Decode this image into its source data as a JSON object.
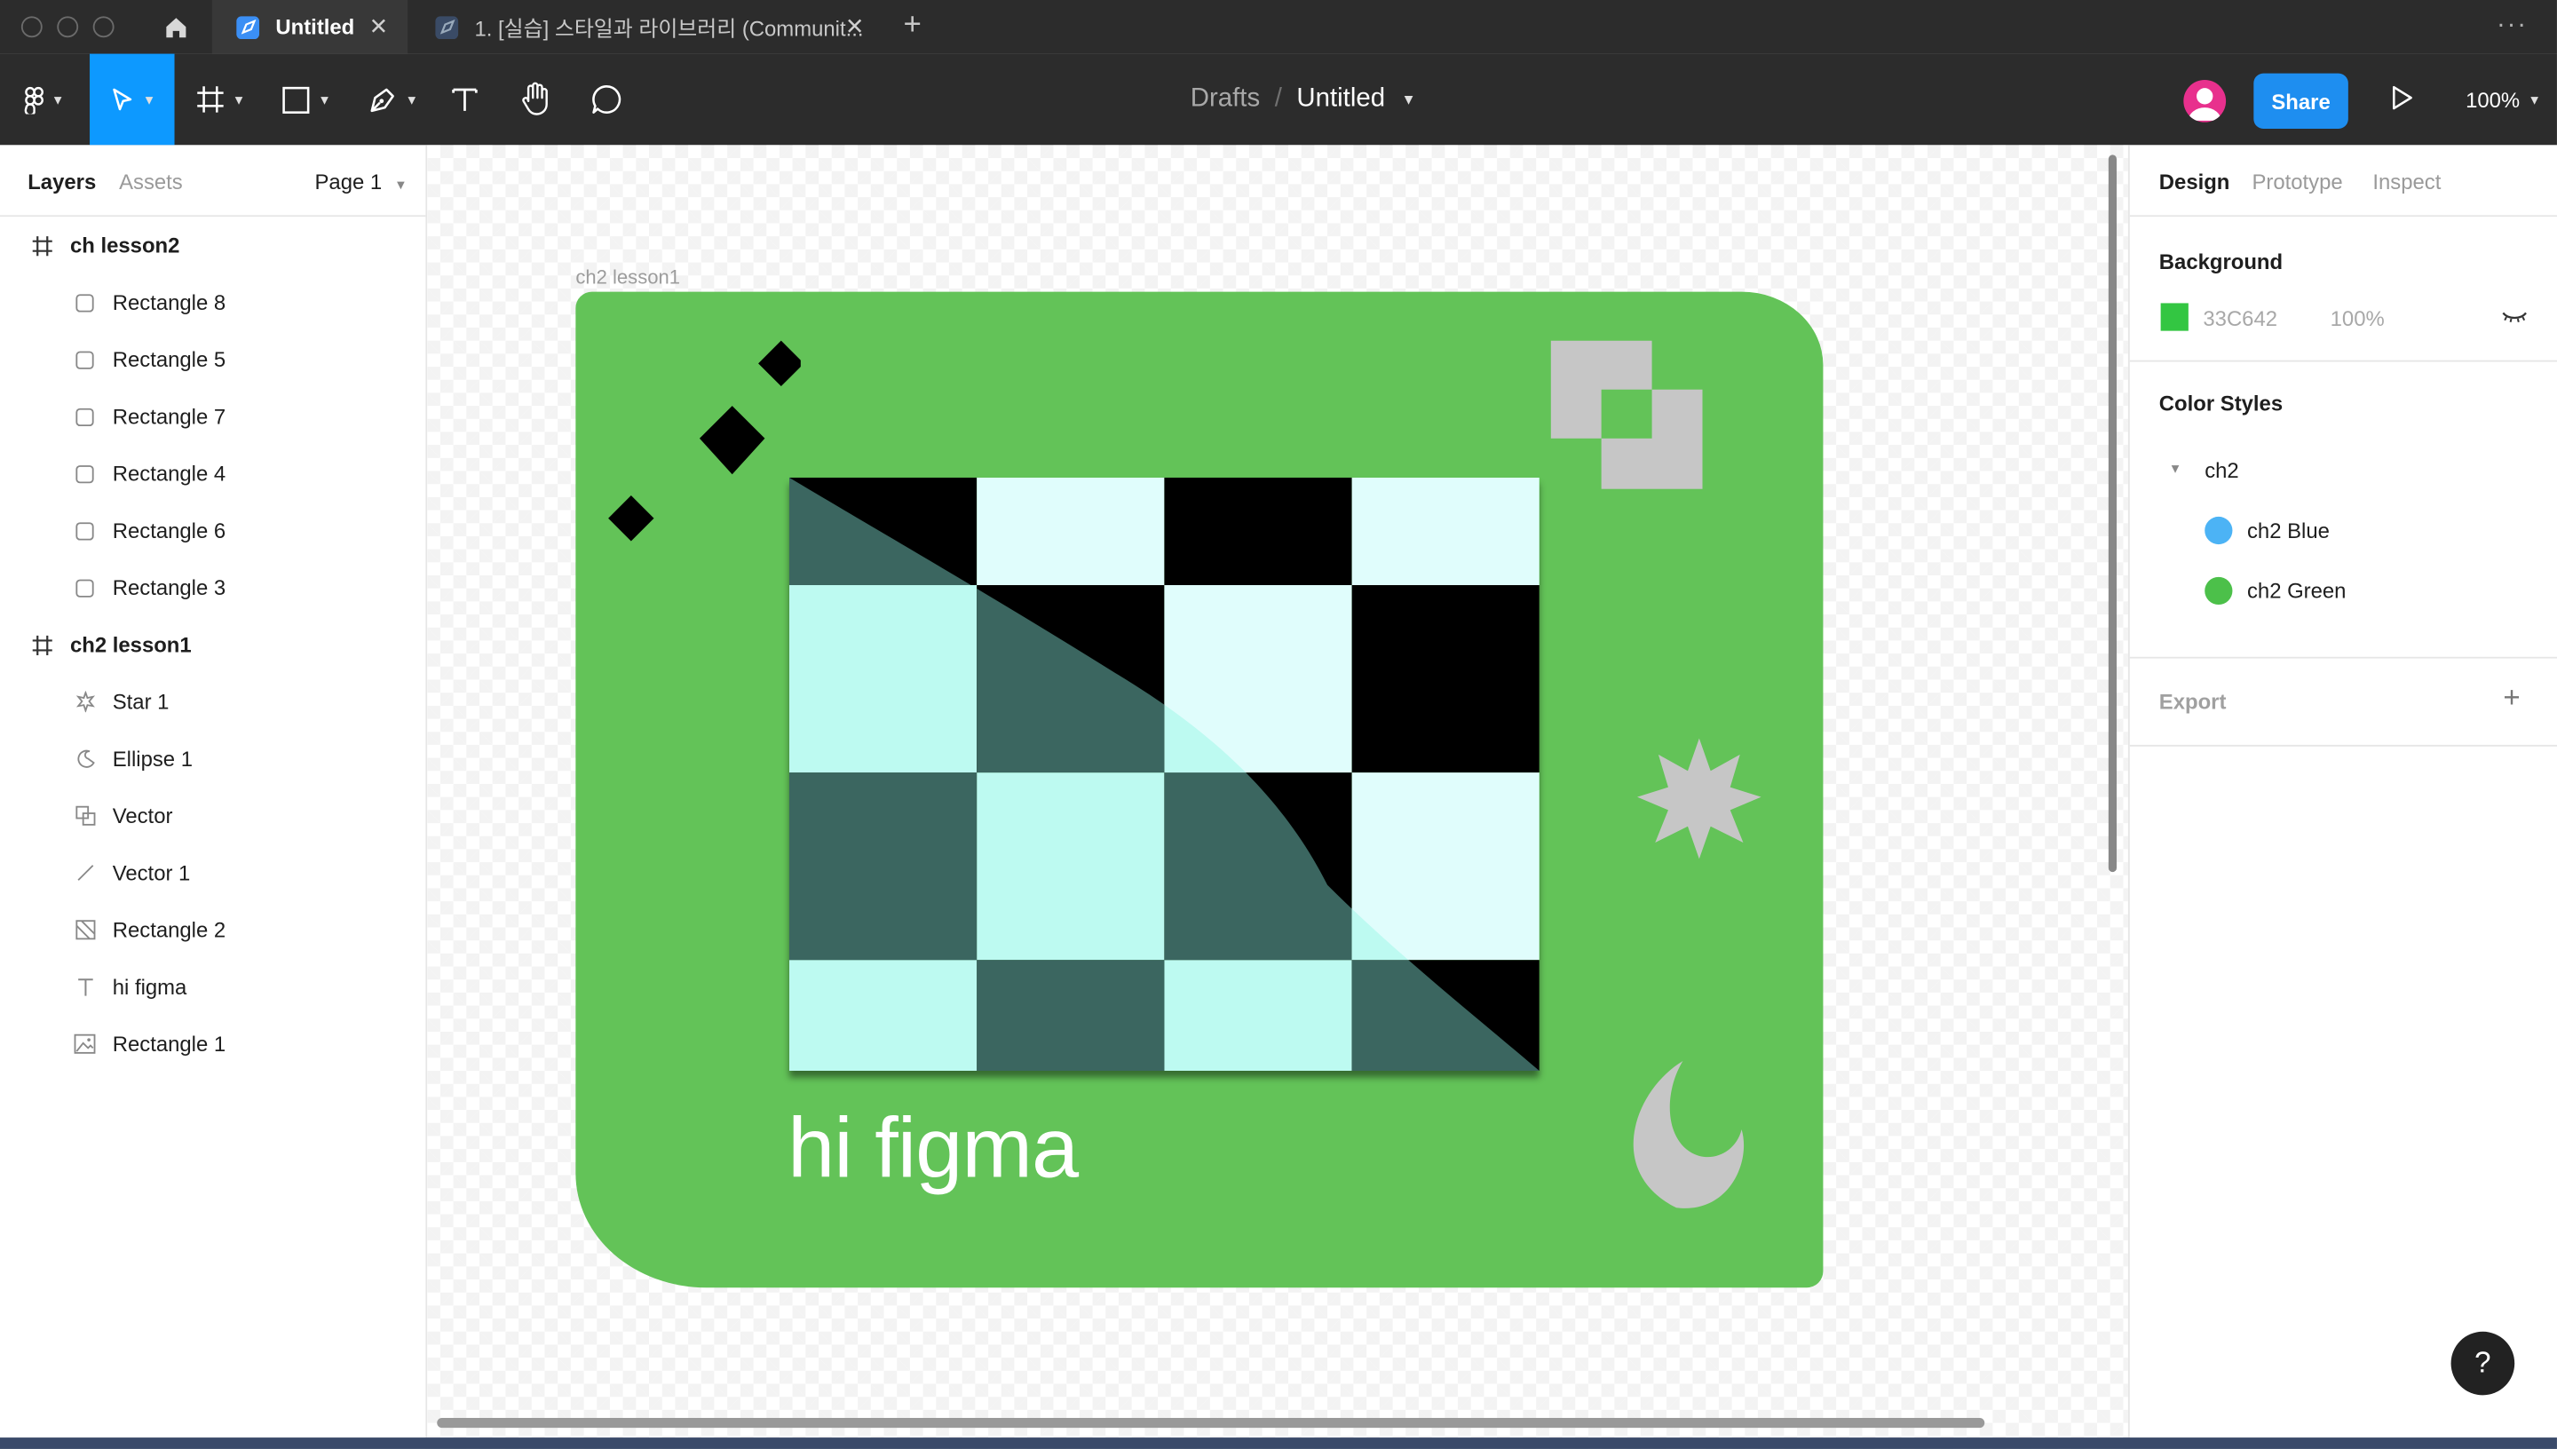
{
  "browser": {
    "home_label": "Home",
    "tabs": [
      {
        "label": "Untitled",
        "active": true
      },
      {
        "label": "1. [실습] 스타일과 라이브러리 (Communit...",
        "active": false
      }
    ],
    "new_tab": "+",
    "more": "···"
  },
  "toolbar": {
    "breadcrumb_root": "Drafts",
    "breadcrumb_sep": "/",
    "file_name": "Untitled",
    "share_label": "Share",
    "zoom": "100%"
  },
  "left_panel": {
    "tab_layers": "Layers",
    "tab_assets": "Assets",
    "page": "Page 1",
    "layers": [
      {
        "name": "ch lesson2",
        "kind": "frame",
        "icon": "frame-icon"
      },
      {
        "name": "Rectangle 8",
        "kind": "child",
        "icon": "rectangle-icon"
      },
      {
        "name": "Rectangle 5",
        "kind": "child",
        "icon": "rectangle-icon"
      },
      {
        "name": "Rectangle 7",
        "kind": "child",
        "icon": "rectangle-icon"
      },
      {
        "name": "Rectangle 4",
        "kind": "child",
        "icon": "rectangle-icon"
      },
      {
        "name": "Rectangle 6",
        "kind": "child",
        "icon": "rectangle-icon"
      },
      {
        "name": "Rectangle 3",
        "kind": "child",
        "icon": "rectangle-icon"
      },
      {
        "name": "ch2 lesson1",
        "kind": "frame",
        "icon": "frame-icon"
      },
      {
        "name": "Star 1",
        "kind": "child",
        "icon": "star-icon"
      },
      {
        "name": "Ellipse 1",
        "kind": "child",
        "icon": "ellipse-icon"
      },
      {
        "name": "Vector",
        "kind": "child",
        "icon": "vector-icon"
      },
      {
        "name": "Vector 1",
        "kind": "child",
        "icon": "line-icon"
      },
      {
        "name": "Rectangle 2",
        "kind": "child",
        "icon": "rectangle-image-icon"
      },
      {
        "name": "hi figma",
        "kind": "child",
        "icon": "text-icon"
      },
      {
        "name": "Rectangle 1",
        "kind": "child",
        "icon": "image-icon"
      }
    ]
  },
  "canvas": {
    "frame_label": "ch2 lesson1",
    "text": "hi figma",
    "frame_color": "#63C358"
  },
  "right_panel": {
    "tab_design": "Design",
    "tab_prototype": "Prototype",
    "tab_inspect": "Inspect",
    "background_title": "Background",
    "background_hex": "33C642",
    "background_opacity": "100%",
    "background_color": "#33C642",
    "color_styles_title": "Color Styles",
    "style_group": "ch2",
    "styles": [
      {
        "name": "ch2 Blue",
        "color": "#4CB3F5"
      },
      {
        "name": "ch2 Green",
        "color": "#4CC04A"
      }
    ],
    "export_title": "Export",
    "export_add": "+"
  },
  "help": "?"
}
